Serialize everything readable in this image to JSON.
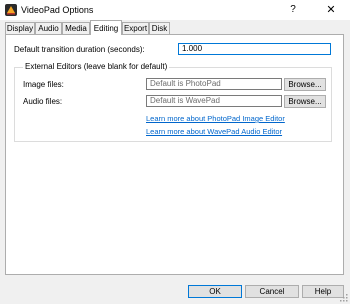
{
  "window": {
    "title": "VideoPad Options",
    "help_label": "?",
    "close_label": "✕"
  },
  "tabs": [
    {
      "label": "Display"
    },
    {
      "label": "Audio"
    },
    {
      "label": "Media"
    },
    {
      "label": "Editing"
    },
    {
      "label": "Export"
    },
    {
      "label": "Disk"
    }
  ],
  "active_tab": "Editing",
  "editing": {
    "transition_label": "Default transition duration (seconds):",
    "transition_value": "1.000",
    "external_group_title": "External Editors (leave blank for default)",
    "image_label": "Image files:",
    "image_placeholder": "Default is PhotoPad",
    "audio_label": "Audio files:",
    "audio_placeholder": "Default is WavePad",
    "browse_label": "Browse...",
    "photopad_link": "Learn more about PhotoPad Image Editor",
    "wavepad_link": "Learn more about WavePad Audio Editor"
  },
  "footer": {
    "ok_label": "OK",
    "cancel_label": "Cancel",
    "help_label": "Help"
  },
  "colors": {
    "accent": "#0078d7",
    "link": "#0066cc"
  }
}
